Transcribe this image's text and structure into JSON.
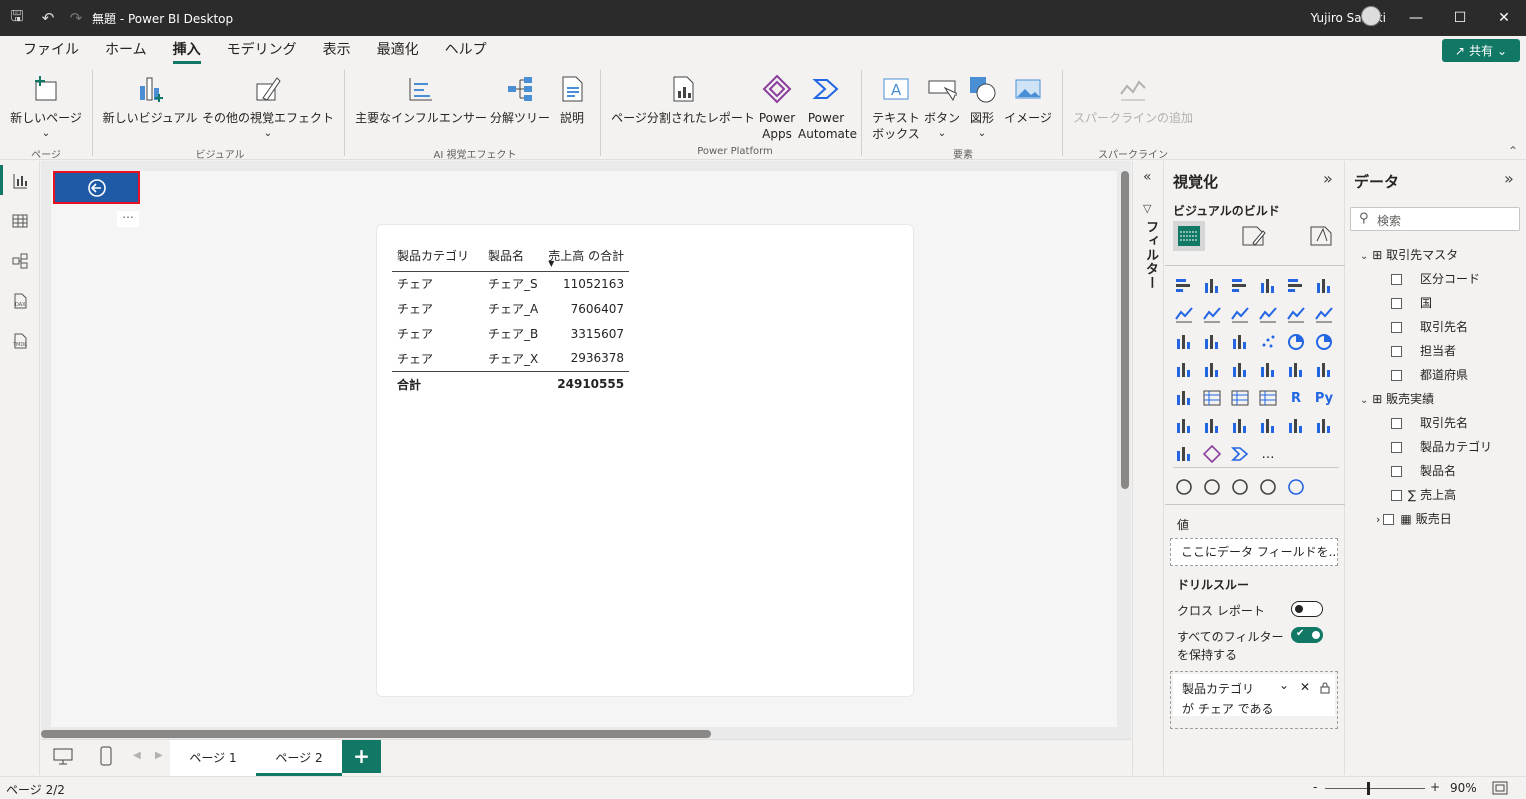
{
  "window": {
    "title": "無題 - Power BI Desktop",
    "user": "Yujiro Sakaki"
  },
  "menu": {
    "items": [
      "ファイル",
      "ホーム",
      "挿入",
      "モデリング",
      "表示",
      "最適化",
      "ヘルプ"
    ],
    "active": "挿入",
    "share": "共有"
  },
  "ribbon": {
    "new_page": "新しいページ",
    "new_visual": "新しいビジュアル",
    "more_visuals": "その他の視覚エフェクト",
    "key_influencers": "主要なインフルエンサー",
    "decomp_tree": "分解ツリー",
    "narrative": "説明",
    "paginated": "ページ分割されたレポート",
    "power_apps_1": "Power",
    "power_apps_2": "Apps",
    "power_automate_1": "Power",
    "power_automate_2": "Automate",
    "textbox_1": "テキスト",
    "textbox_2": "ボックス",
    "button": "ボタン",
    "shapes": "図形",
    "image": "イメージ",
    "sparkline": "スパークラインの追加",
    "groups": {
      "pages": "ページ",
      "visuals": "ビジュアル",
      "ai": "AI 視覚エフェクト",
      "platform": "Power Platform",
      "elements": "要素",
      "sparklines": "スパークライン"
    }
  },
  "table": {
    "headers": [
      "製品カテゴリ",
      "製品名",
      "売上高 の合計"
    ],
    "rows": [
      [
        "チェア",
        "チェア_S",
        "11052163"
      ],
      [
        "チェア",
        "チェア_A",
        "7606407"
      ],
      [
        "チェア",
        "チェア_B",
        "3315607"
      ],
      [
        "チェア",
        "チェア_X",
        "2936378"
      ]
    ],
    "total_label": "合計",
    "total_value": "24910555"
  },
  "pages": {
    "tab1": "ページ 1",
    "tab2": "ページ 2",
    "add": "+"
  },
  "status": {
    "page": "ページ 2/2",
    "zoom": "90%",
    "minus": "-",
    "plus": "+"
  },
  "filters": {
    "label": "フィルター"
  },
  "viz": {
    "title": "視覚化",
    "build": "ビジュアルのビルド",
    "values": "値",
    "field_placeholder": "ここにデータ フィールドを...",
    "drill": "ドリルスルー",
    "cross_report": "クロス レポート",
    "keep_filters_1": "すべてのフィルター",
    "keep_filters_2": "を保持する",
    "filter_card_1": "製品カテゴリ",
    "filter_card_2": "が チェア である",
    "more": "…",
    "r": "R",
    "py": "Py"
  },
  "data": {
    "title": "データ",
    "search_placeholder": "検索",
    "table1": "取引先マスタ",
    "fields1": [
      "区分コード",
      "国",
      "取引先名",
      "担当者",
      "都道府県"
    ],
    "table2": "販売実績",
    "fields2": [
      "取引先名",
      "製品カテゴリ",
      "製品名",
      "売上高",
      "販売日"
    ]
  },
  "colors": {
    "accent": "#117865",
    "back_button": "#1f5aa6",
    "highlight_border": "#e81123"
  }
}
